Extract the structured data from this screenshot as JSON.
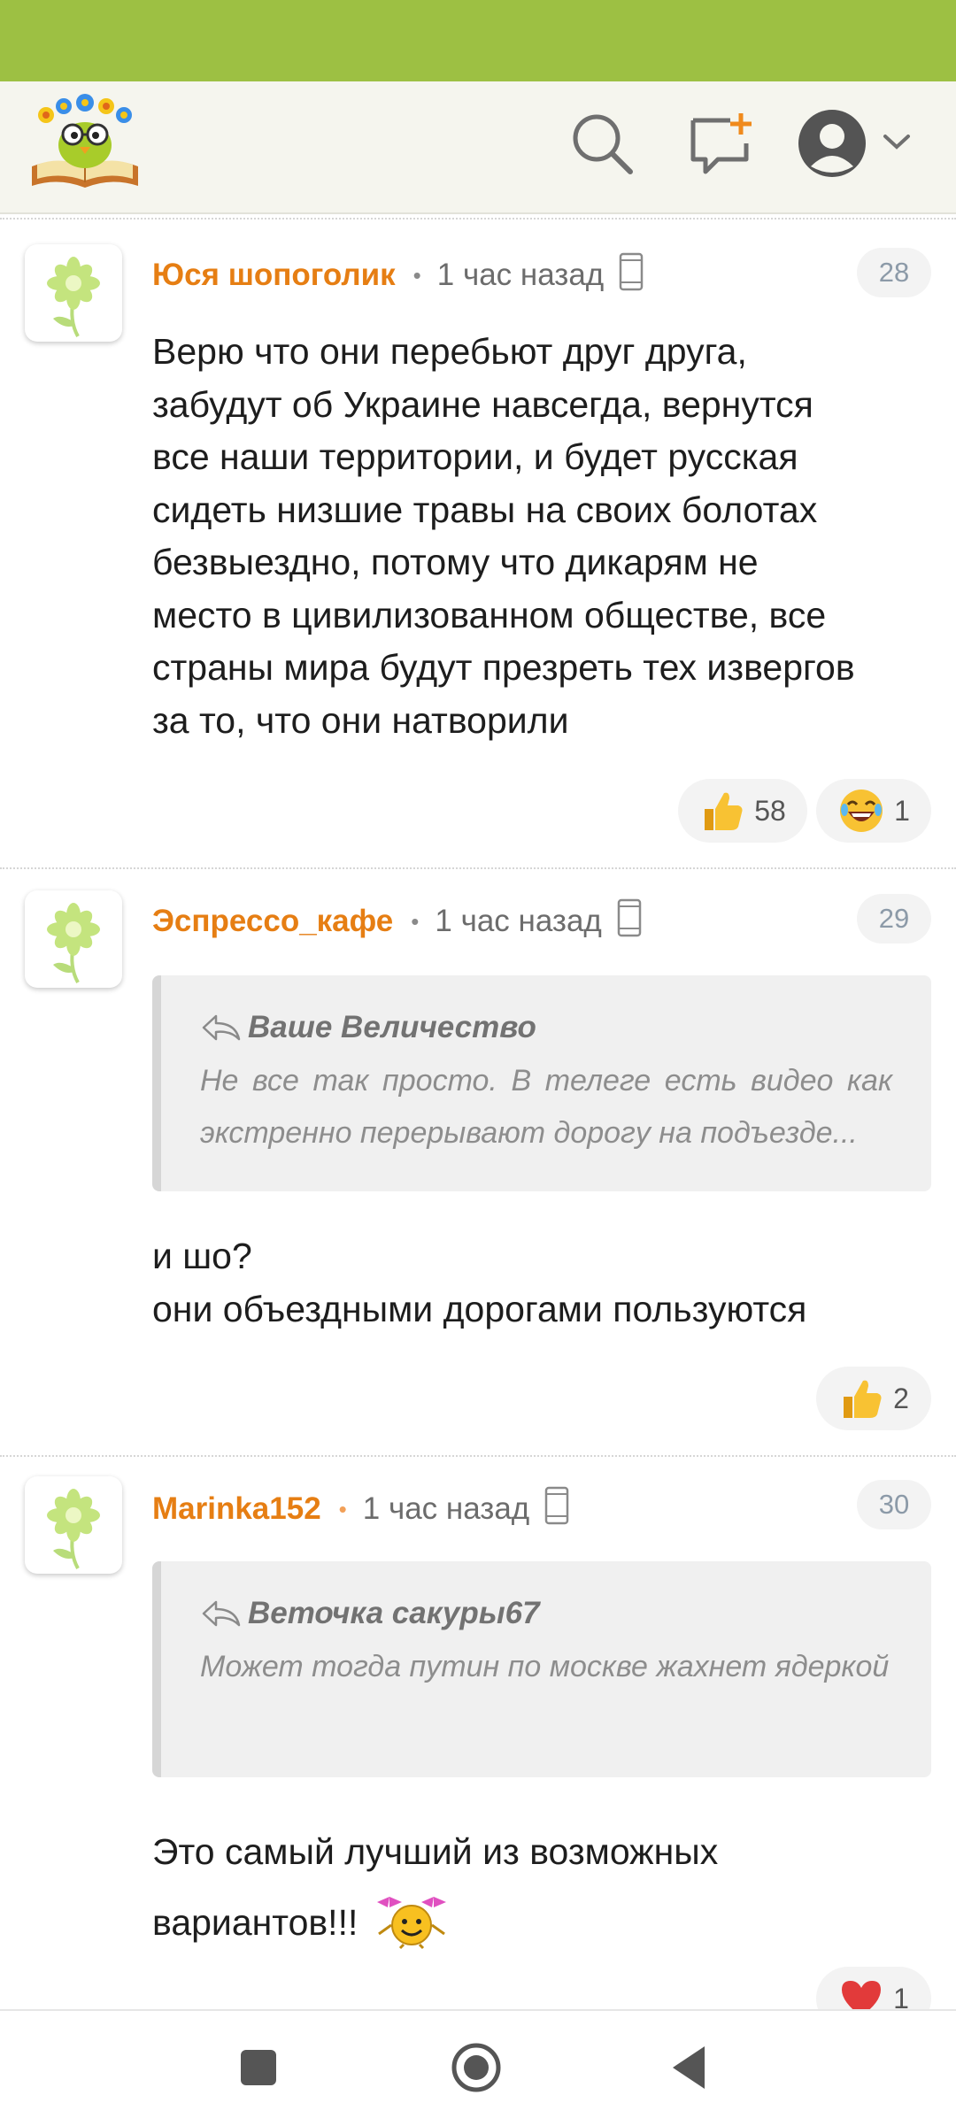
{
  "app": {
    "logo_icon": "owl-books-logo",
    "accent": "#9dc043",
    "author_color": "#e67e13"
  },
  "header": {
    "icons": [
      "search-icon",
      "new-post-icon",
      "profile-icon",
      "chevron-down-icon"
    ]
  },
  "comments": [
    {
      "author": "Юся шопоголик",
      "time": "1 час назад",
      "number": "28",
      "text_lines": [
        "Верю что они перебьют друг друга,",
        "забудут об Украине навсегда, вернутся",
        "все наши территории, и будет русская",
        "сидеть низшие травы на своих болотах",
        "безвыездно, потому что дикарям не",
        "место в цивилизованном обществе, все",
        "страны мира будут презреть тех извергов",
        "за то, что они натворили"
      ],
      "reactions": [
        {
          "icon": "thumbs-up-icon",
          "count": "58"
        },
        {
          "icon": "laughing-face-icon",
          "count": "1"
        }
      ]
    },
    {
      "author": "Эспрессо_кафе",
      "time": "1 час назад",
      "number": "29",
      "quote": {
        "author": "Ваше Величество",
        "text": "Не все так просто. В телеге есть видео как экстренно перерывают дорогу на подъезде..."
      },
      "text_lines": [
        "и шо?",
        "они объездными дорогами пользуются"
      ],
      "reactions": [
        {
          "icon": "thumbs-up-icon",
          "count": "2"
        }
      ]
    },
    {
      "author": "Marinka152",
      "time": "1 час назад",
      "number": "30",
      "quote": {
        "author": "Веточка сакуры67",
        "text": "Может тогда путин по москве жахнет ядеркой"
      },
      "text_lines": [
        "Это самый лучший из возможных",
        "вариантов!!!"
      ],
      "emoji": "smiley-with-bows-icon",
      "reactions": [
        {
          "icon": "heart-icon",
          "count": "1"
        }
      ]
    }
  ],
  "navbar": {
    "icons": [
      "recent-apps-icon",
      "home-icon",
      "back-icon"
    ]
  }
}
